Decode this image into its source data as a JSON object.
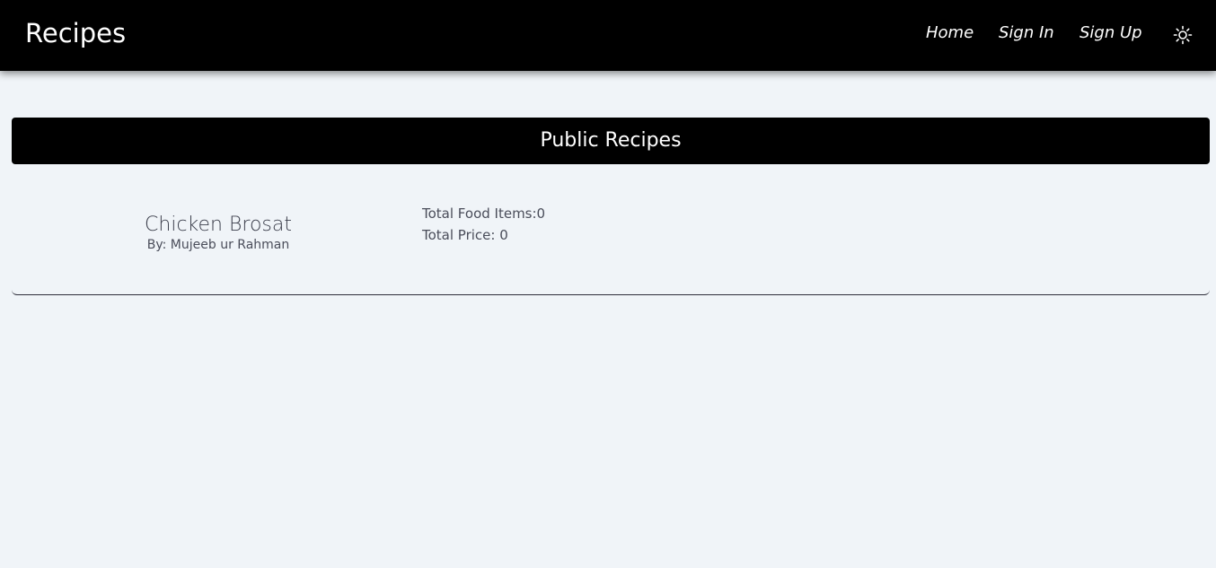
{
  "header": {
    "brand": "Recipes",
    "nav": {
      "home": "Home",
      "sign_in": "Sign In",
      "sign_up": "Sign Up"
    },
    "theme_icon": "sun-icon"
  },
  "main": {
    "section_title": "Public Recipes",
    "recipes": [
      {
        "name": "Chicken Brosat",
        "author": "By: Mujeeb ur Rahman",
        "total_items": "Total Food Items:0",
        "total_price": "Total Price: 0"
      }
    ]
  },
  "colors": {
    "background": "#f0f4f8",
    "header_bg": "#000000",
    "text_light": "#ffffff",
    "text_muted": "#4a4d5a"
  }
}
